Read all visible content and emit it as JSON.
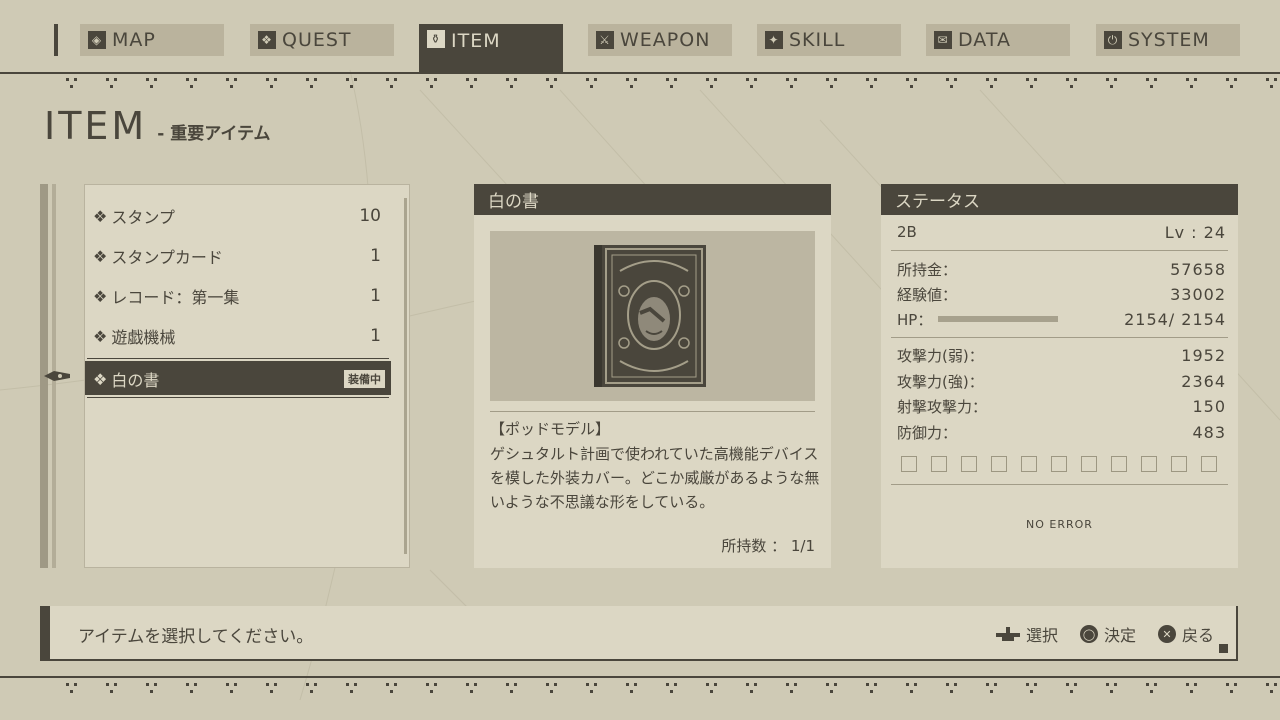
{
  "nav": {
    "tabs": [
      {
        "label": "MAP",
        "icon": "map-icon",
        "glyph": "◈"
      },
      {
        "label": "QUEST",
        "icon": "quest-icon",
        "glyph": "❖"
      },
      {
        "label": "ITEM",
        "icon": "item-icon",
        "glyph": "⚱"
      },
      {
        "label": "WEAPON",
        "icon": "weapon-icon",
        "glyph": "⚔"
      },
      {
        "label": "SKILL",
        "icon": "skill-icon",
        "glyph": "✦"
      },
      {
        "label": "DATA",
        "icon": "data-icon",
        "glyph": "✉"
      },
      {
        "label": "SYSTEM",
        "icon": "system-icon",
        "glyph": "⏻"
      }
    ],
    "active": "ITEM"
  },
  "page": {
    "title": "ITEM",
    "subtitle": "- 重要アイテム"
  },
  "item_list": [
    {
      "name": "スタンプ",
      "qty": "10"
    },
    {
      "name": "スタンプカード",
      "qty": "1"
    },
    {
      "name": "レコード：第一集",
      "qty": "1"
    },
    {
      "name": "遊戯機械",
      "qty": "1"
    },
    {
      "name": "白の書",
      "qty": "",
      "badge": "装備中",
      "selected": true
    }
  ],
  "detail": {
    "header": "白の書",
    "desc_title": "【ポッドモデル】",
    "desc_body": "ゲシュタルト計画で使われていた高機能デバイスを模した外装カバー。どこか威厳があるような無いような不思議な形をしている。",
    "owned": "所持数 ： 1/1"
  },
  "status": {
    "header": "ステータス",
    "name": "2B",
    "level": "Lv : 24",
    "money_label": "所持金：",
    "money": "57658",
    "exp_label": "経験値：",
    "exp": "33002",
    "hp_label": "HP：",
    "hp": "2154/ 2154",
    "hp_fraction": 1.0,
    "atk_weak_label": "攻撃力(弱)：",
    "atk_weak": "1952",
    "atk_strong_label": "攻撃力(強)：",
    "atk_strong": "2364",
    "ranged_label": "射撃攻撃力：",
    "ranged": "150",
    "def_label": "防御力：",
    "def": "483",
    "slots": 11,
    "error": "NO ERROR"
  },
  "help": {
    "message": "アイテムを選択してください。",
    "select": "選択",
    "confirm": "決定",
    "back": "戻る"
  },
  "colors": {
    "bg": "#cfcab5",
    "panel": "#dcd7c4",
    "ink": "#4a463c"
  }
}
